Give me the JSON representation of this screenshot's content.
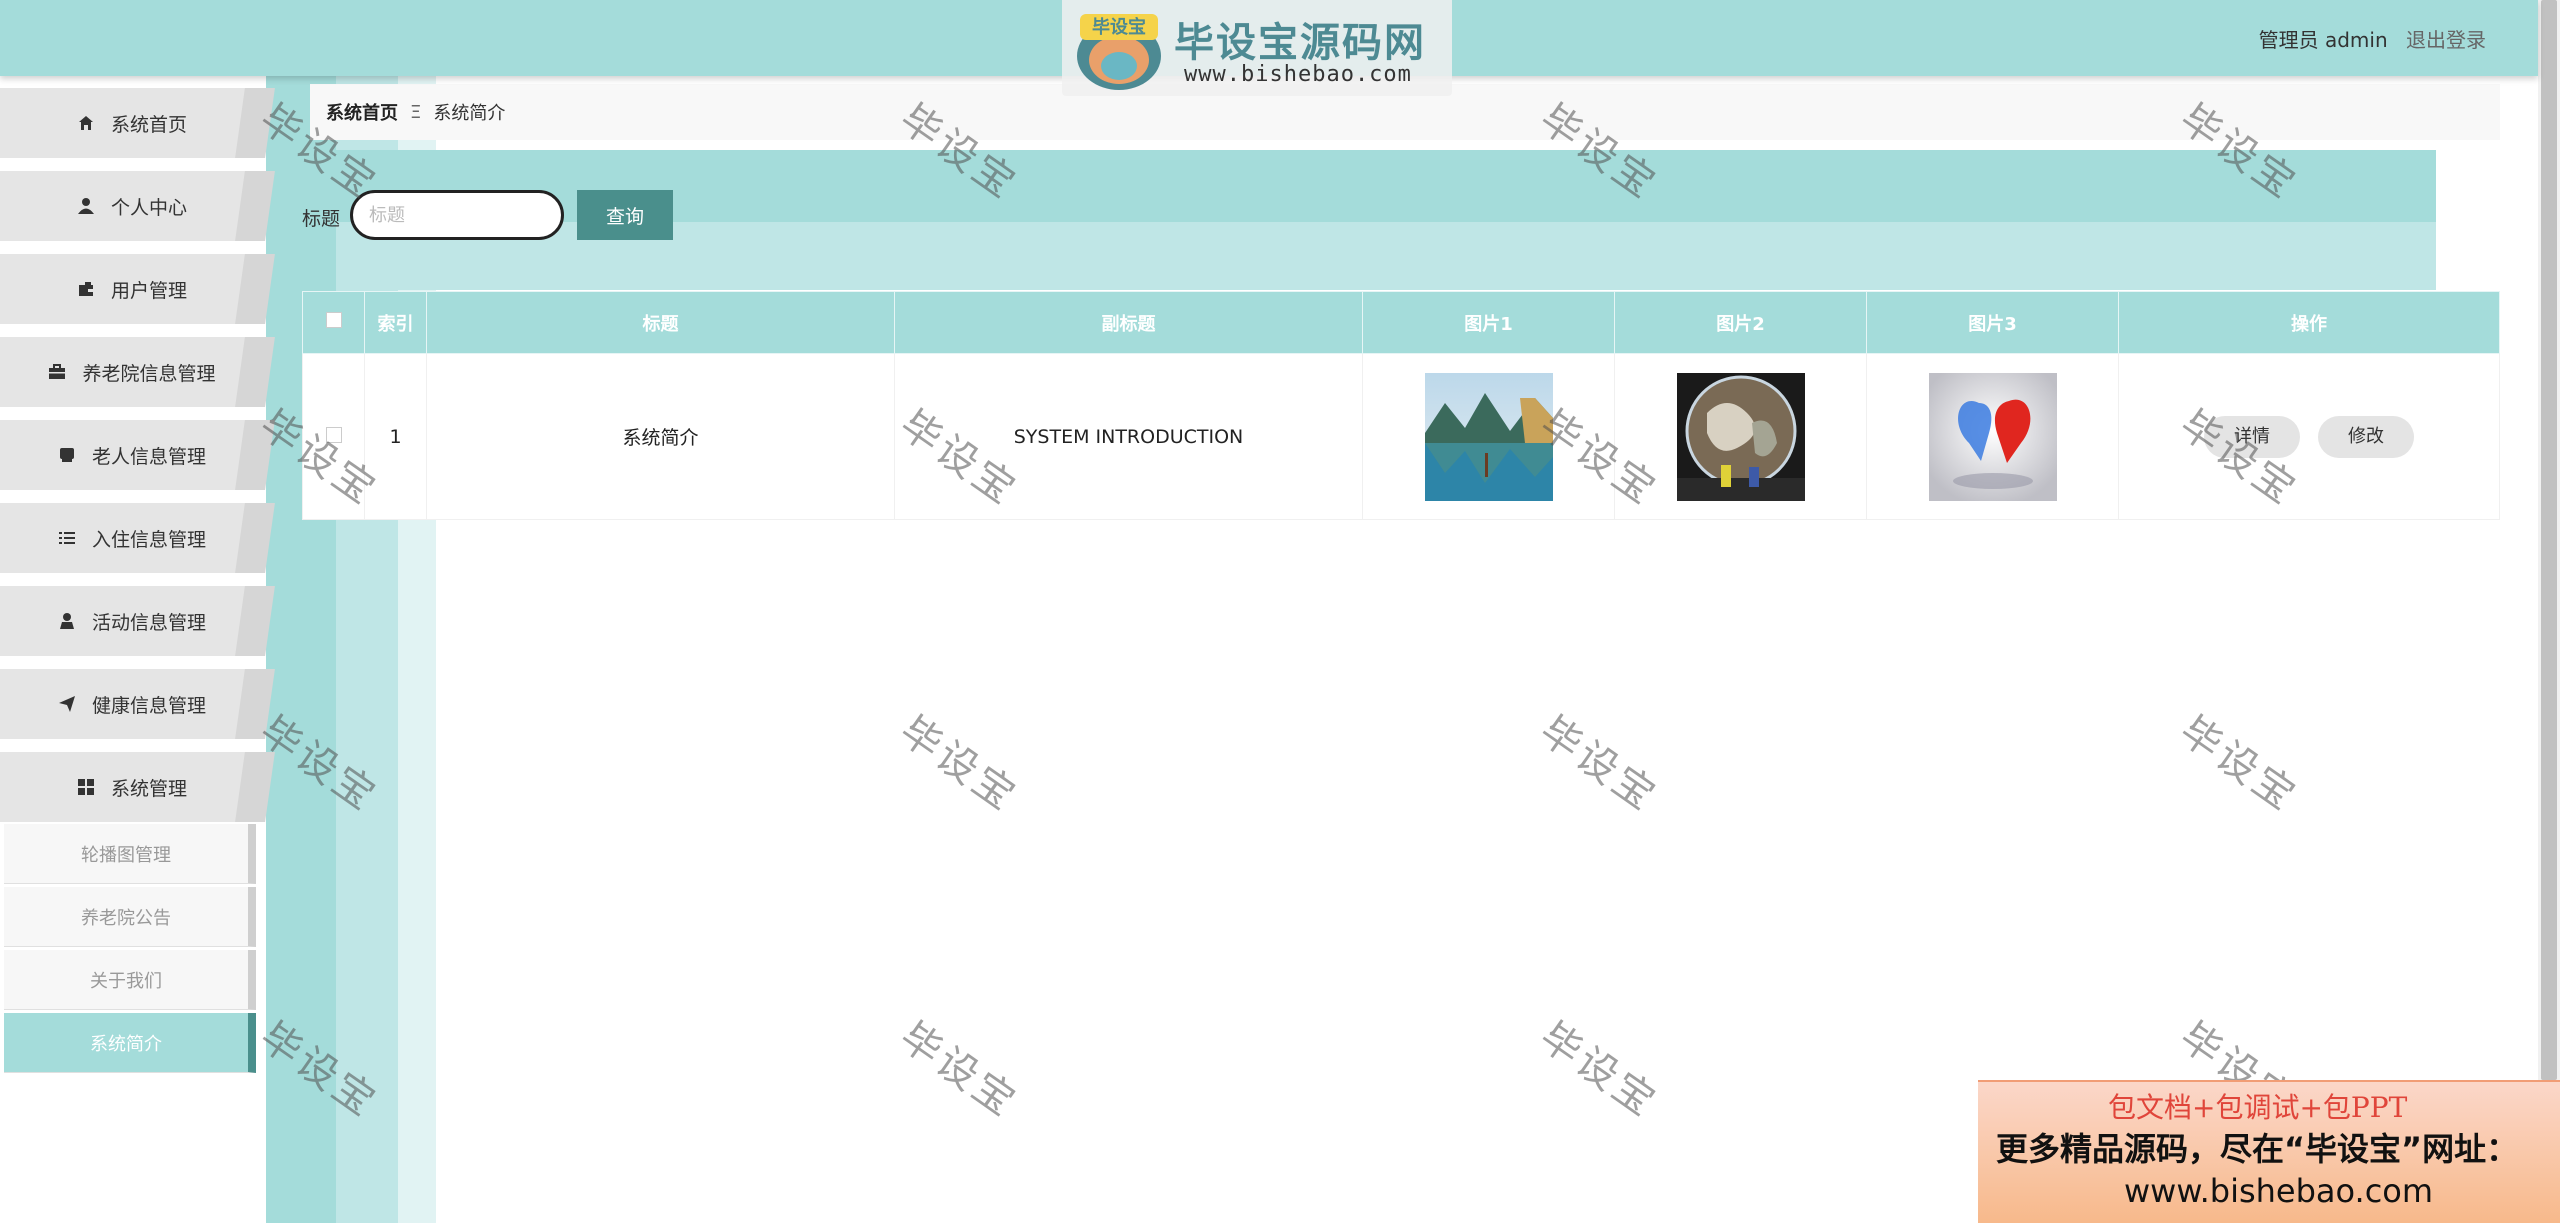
{
  "header": {
    "logo_badge": "毕设宝",
    "logo_title": "毕设宝源码网",
    "logo_url": "www.bishebao.com",
    "user_label": "管理员 admin",
    "logout_label": "退出登录"
  },
  "sidebar": {
    "items": [
      {
        "label": "系统首页",
        "icon": "home-icon"
      },
      {
        "label": "个人中心",
        "icon": "user-icon"
      },
      {
        "label": "用户管理",
        "icon": "wallet-icon"
      },
      {
        "label": "养老院信息管理",
        "icon": "briefcase-icon"
      },
      {
        "label": "老人信息管理",
        "icon": "inbox-icon"
      },
      {
        "label": "入住信息管理",
        "icon": "list-icon"
      },
      {
        "label": "活动信息管理",
        "icon": "person-icon"
      },
      {
        "label": "健康信息管理",
        "icon": "send-icon"
      },
      {
        "label": "系统管理",
        "icon": "grid-icon"
      }
    ],
    "sub_items": [
      {
        "label": "轮播图管理"
      },
      {
        "label": "养老院公告"
      },
      {
        "label": "关于我们"
      },
      {
        "label": "系统简介",
        "active": true
      }
    ]
  },
  "breadcrumb": {
    "home": "系统首页",
    "separator": "Ξ",
    "current": "系统简介"
  },
  "search": {
    "label": "标题",
    "placeholder": "标题",
    "button": "查询"
  },
  "table": {
    "headers": [
      "索引",
      "标题",
      "副标题",
      "图片1",
      "图片2",
      "图片3",
      "操作"
    ],
    "rows": [
      {
        "index": "1",
        "title": "系统简介",
        "subtitle": "SYSTEM INTRODUCTION",
        "detail": "详情",
        "edit": "修改"
      }
    ]
  },
  "watermark": "毕设宝",
  "ad": {
    "line1": "包文档+包调试+包PPT",
    "line2": "更多精品源码，尽在“毕设宝”网址：",
    "line3": "www.bishebao.com"
  },
  "colors": {
    "primary": "#a4dcda",
    "dark": "#4a8f8c",
    "light": "#bfe6e6"
  }
}
